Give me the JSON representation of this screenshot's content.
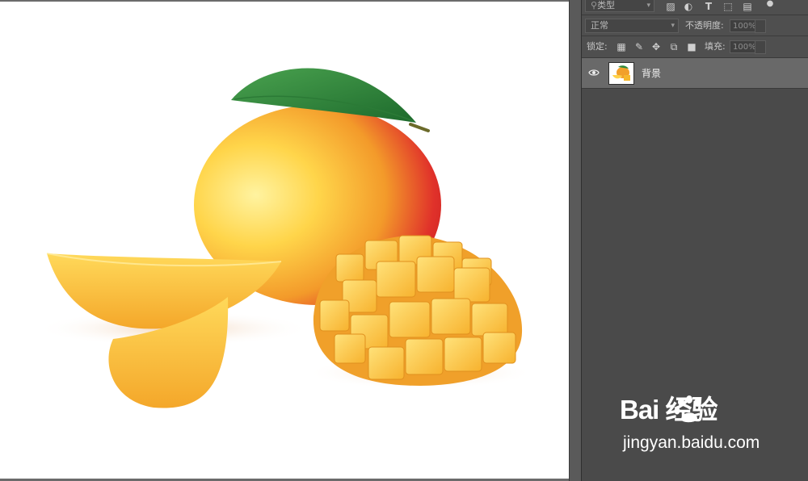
{
  "layers_panel": {
    "filter": {
      "kind_label": "类型",
      "icons": [
        "image-filter-icon",
        "adjustment-filter-icon",
        "type-filter-icon",
        "shape-filter-icon",
        "smart-object-filter-icon",
        "filter-toggle-icon"
      ]
    },
    "blend_mode": "正常",
    "opacity_label": "不透明度:",
    "opacity_value": "100%",
    "lock_label": "锁定:",
    "lock_icons": [
      "lock-transparent-pixels-icon",
      "lock-image-pixels-icon",
      "lock-position-icon",
      "lock-artboard-icon",
      "lock-all-icon"
    ],
    "fill_label": "填充:",
    "fill_value": "100%",
    "layers": [
      {
        "name": "背景",
        "visible": true
      }
    ]
  },
  "watermark": {
    "logo": "Bai 经验",
    "url": "jingyan.baidu.com"
  }
}
